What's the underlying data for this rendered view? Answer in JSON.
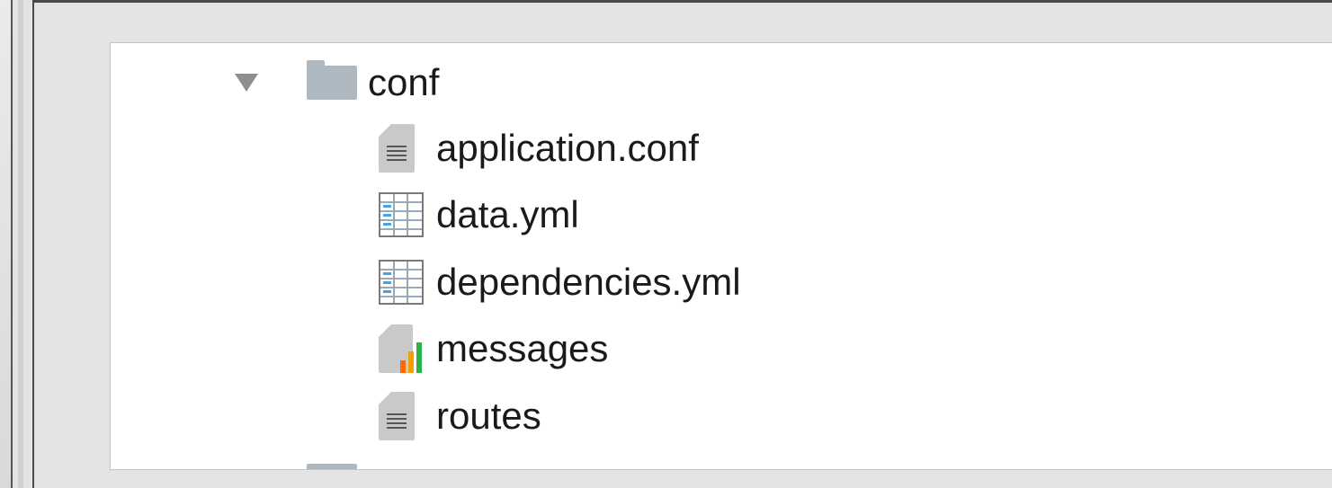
{
  "tree": {
    "folder": {
      "label": "conf",
      "icon": "folder-icon",
      "expanded": true
    },
    "files": [
      {
        "label": "application.conf",
        "icon": "text-document-icon"
      },
      {
        "label": "data.yml",
        "icon": "spreadsheet-document-icon"
      },
      {
        "label": "dependencies.yml",
        "icon": "spreadsheet-document-icon"
      },
      {
        "label": "messages",
        "icon": "chart-document-icon"
      },
      {
        "label": "routes",
        "icon": "text-document-icon"
      }
    ]
  },
  "colors": {
    "folder": "#aeb8c1",
    "disclosure": "#8e8e8e",
    "text": "#1a1a1a",
    "list_background": "#ffffff"
  }
}
